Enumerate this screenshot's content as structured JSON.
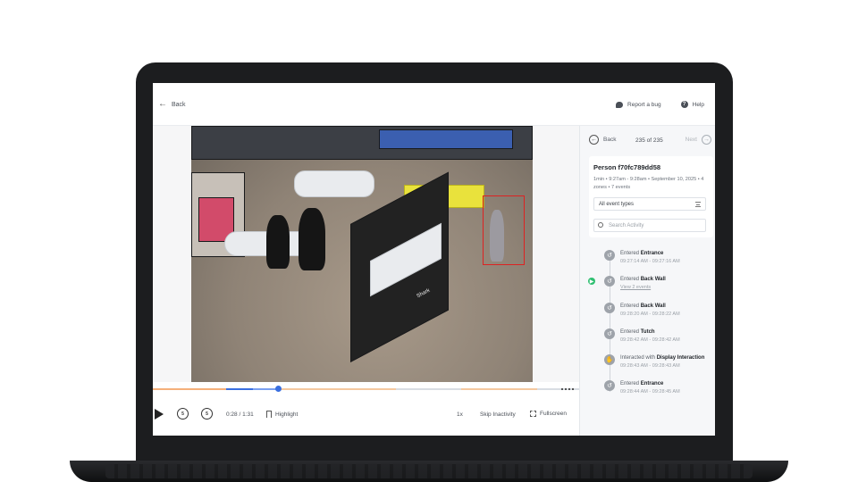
{
  "header": {
    "back_label": "Back",
    "report_bug_label": "Report a bug",
    "help_label": "Help",
    "help_icon_glyph": "?"
  },
  "player": {
    "time": "0:28 / 1:31",
    "highlight_label": "Highlight",
    "speed": "1x",
    "skip_inactivity_label": "Skip Inactivity",
    "fullscreen_label": "Fullscreen",
    "skip_back_seconds": "5",
    "skip_forward_seconds": "5",
    "progress_fraction": 0.3,
    "accent_color": "#3a6fe0",
    "segment_color": "#f5b07a"
  },
  "video_overlay": {
    "shelf_brand_text": "Shark"
  },
  "panel": {
    "nav": {
      "back_label": "Back",
      "count": "235 of 235",
      "next_label": "Next"
    },
    "person": {
      "title": "Person f70fc789dd58",
      "meta": "1min • 9:27am - 9:28am • September 10, 2025 • 4 zones • 7 events"
    },
    "filter": {
      "value": "All event types"
    },
    "search": {
      "placeholder": "Search Activity"
    },
    "events": [
      {
        "prefix": "Entered",
        "zone": "Entrance",
        "time": "09:27:14 AM - 09:27:16 AM",
        "extra": ""
      },
      {
        "prefix": "Entered",
        "zone": "Back Wall",
        "time": "",
        "extra": "View 2 events"
      },
      {
        "prefix": "Entered",
        "zone": "Back Wall",
        "time": "09:28:20 AM - 09:28:22 AM",
        "extra": ""
      },
      {
        "prefix": "Entered",
        "zone": "Tutch",
        "time": "09:28:42 AM - 09:28:42 AM",
        "extra": ""
      },
      {
        "prefix": "Interacted with",
        "zone": "Display Interaction",
        "time": "09:28:43 AM - 09:28:43 AM",
        "extra": ""
      },
      {
        "prefix": "Entered",
        "zone": "Entrance",
        "time": "09:28:44 AM - 09:28:45 AM",
        "extra": ""
      }
    ],
    "active_event_color": "#2fbf71"
  }
}
